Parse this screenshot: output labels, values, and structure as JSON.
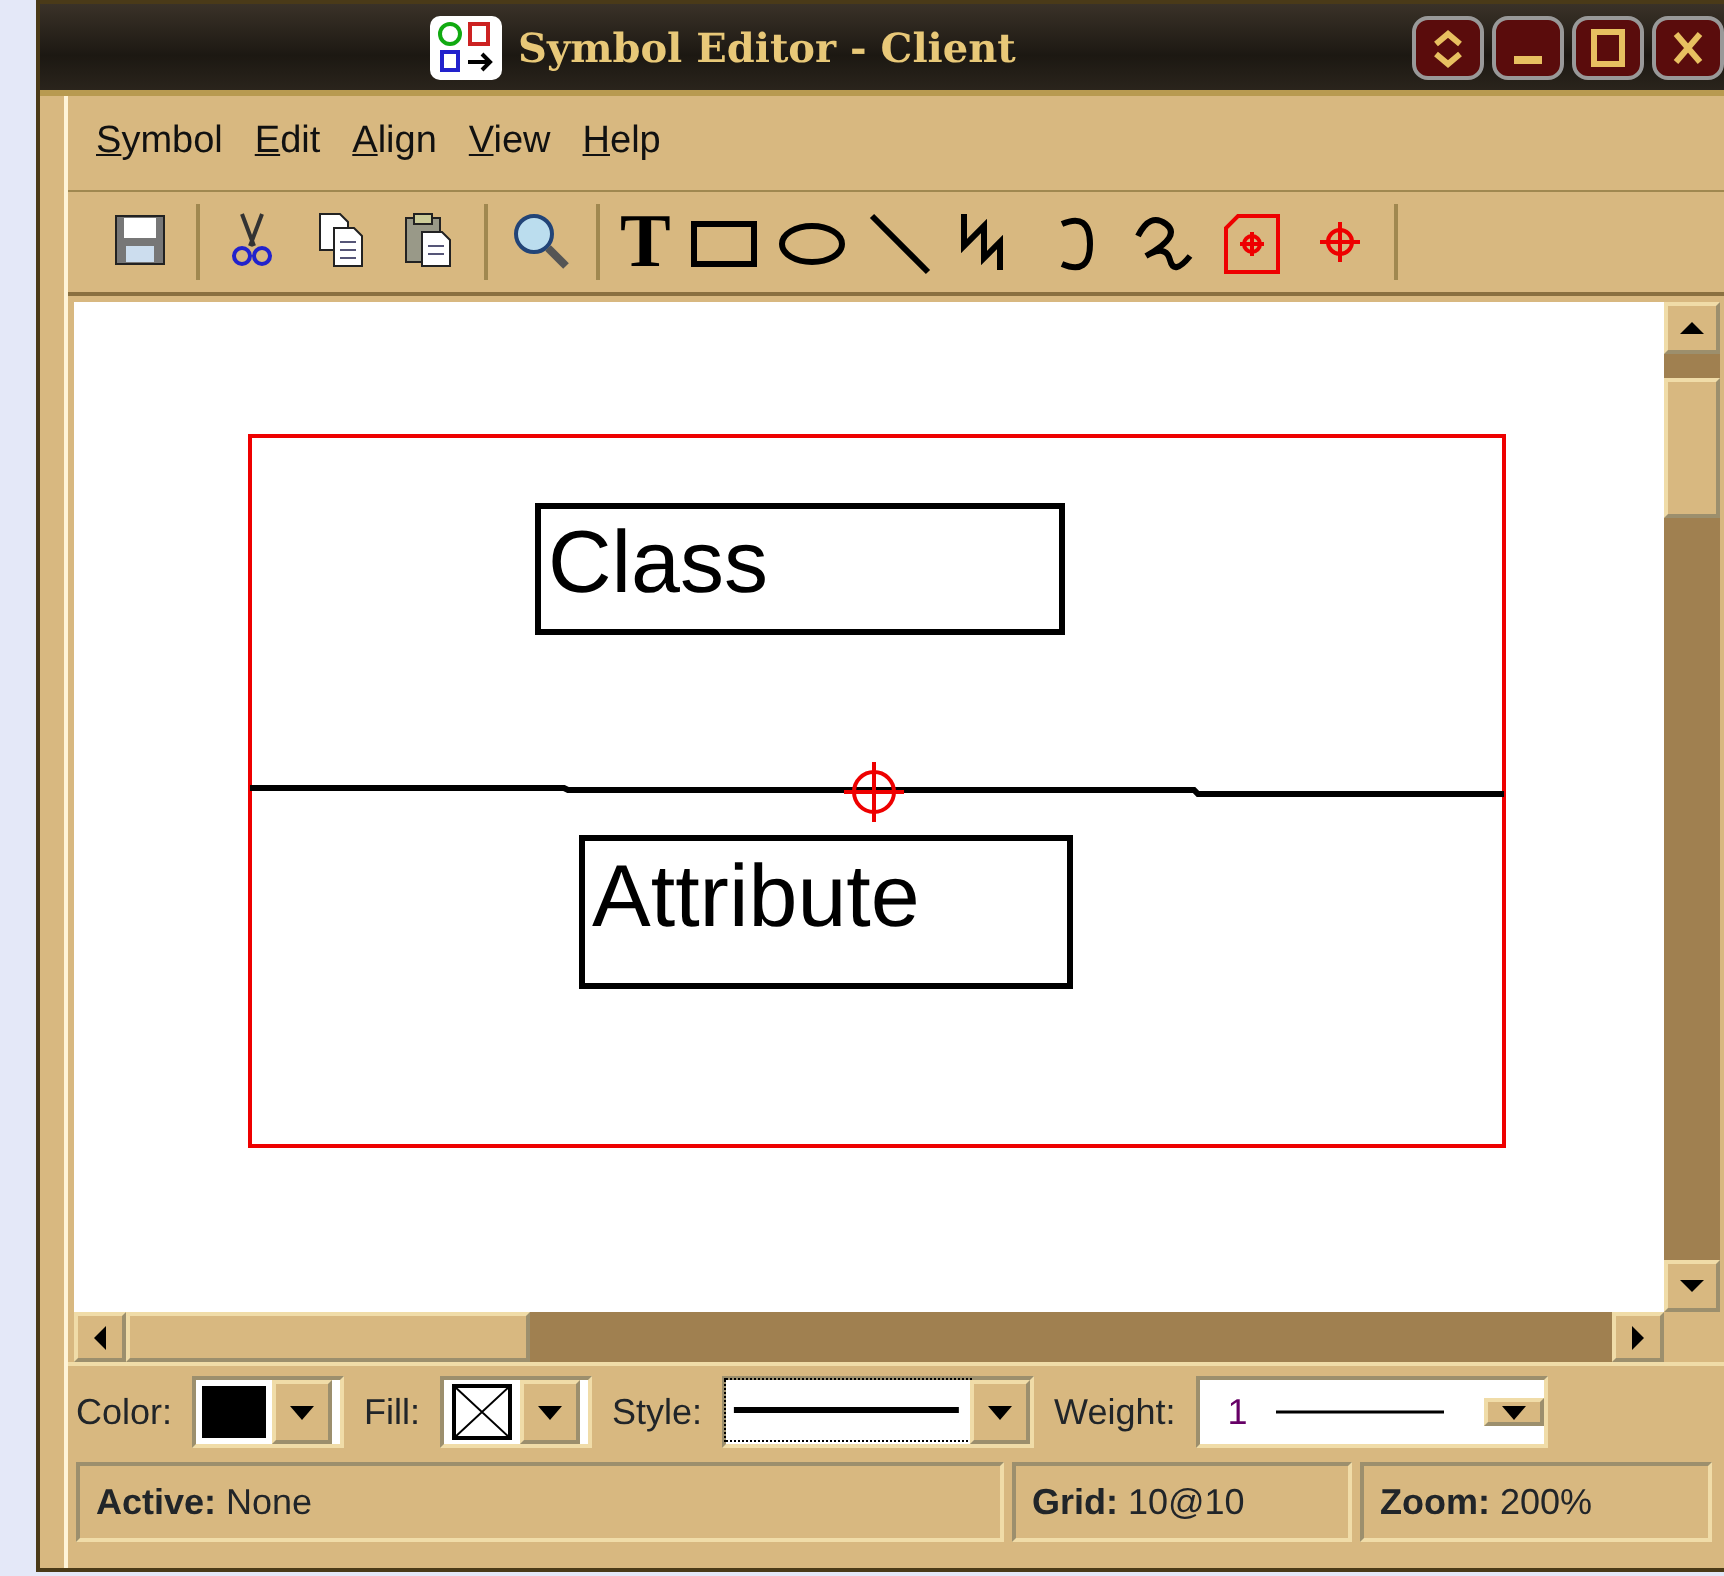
{
  "window": {
    "title": "Symbol Editor - Client"
  },
  "menu": [
    {
      "label": "Symbol"
    },
    {
      "label": "Edit"
    },
    {
      "label": "Align"
    },
    {
      "label": "View"
    },
    {
      "label": "Help"
    }
  ],
  "toolbar_groups": [
    [
      {
        "kind": "save"
      }
    ],
    [
      {
        "kind": "cut"
      },
      {
        "kind": "copy"
      },
      {
        "kind": "paste"
      }
    ],
    [
      {
        "kind": "zoom"
      }
    ],
    [
      {
        "kind": "text",
        "glyph": "T"
      },
      {
        "kind": "rect"
      },
      {
        "kind": "ellipse"
      },
      {
        "kind": "line"
      },
      {
        "kind": "polyline"
      },
      {
        "kind": "arc"
      },
      {
        "kind": "curve"
      },
      {
        "kind": "port"
      },
      {
        "kind": "origin"
      }
    ]
  ],
  "canvas": {
    "compartments": [
      {
        "kind": "name",
        "text": "Class"
      },
      {
        "kind": "attributes",
        "text": "Attribute"
      }
    ]
  },
  "properties": [
    {
      "kind": "color",
      "label": "Color:",
      "color": "#000000"
    },
    {
      "kind": "fill",
      "label": "Fill:"
    },
    {
      "kind": "style",
      "label": "Style:",
      "focused": true
    },
    {
      "kind": "weight",
      "label": "Weight:",
      "value": "1"
    }
  ],
  "status_bar": [
    {
      "text": "**Active:** None"
    },
    {
      "text": "**Grid:** 10@10"
    },
    {
      "text": "**Zoom:** 200%"
    }
  ]
}
